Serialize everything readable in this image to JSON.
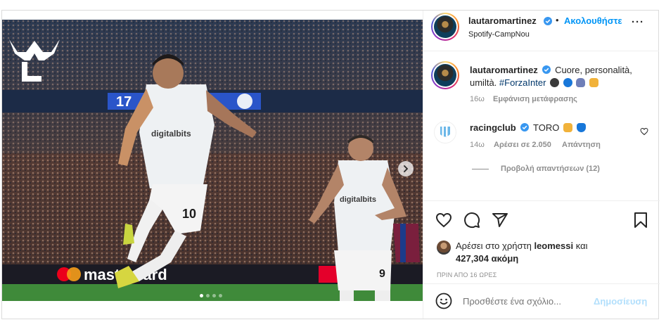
{
  "post": {
    "author": "lautaromartinez",
    "follow_label": "Ακολουθήστε",
    "location": "Spotify-CampNou",
    "dot": "•",
    "more_label": "···"
  },
  "caption": {
    "username": "lautaromartinez",
    "text_line1": "Cuore, personalità,",
    "text_line2_a": "umiltà.",
    "hashtag": "#ForzaInter",
    "time": "16ω",
    "translate_label": "Εμφάνιση μετάφρασης"
  },
  "comment": {
    "username": "racingclub",
    "text": "TORO",
    "time": "14ω",
    "likes": "Αρέσει σε 2.050",
    "reply_label": "Απάντηση",
    "view_replies": "Προβολή απαντήσεων (12)"
  },
  "likes": {
    "prefix": "Αρέσει στο χρήστη",
    "user": "leomessi",
    "suffix": "και",
    "count": "427,304 ακόμη",
    "timestamp": "ΠΡΙΝ ΑΠΟ 16 ΩΡΕΣ"
  },
  "composer": {
    "placeholder": "Προσθέστε ένα σχόλιο...",
    "post_label": "Δημοσίευση"
  },
  "media": {
    "shirt_sponsor": "digitalbits",
    "shirt_number_left": "10",
    "shirt_number_right": "9",
    "board_text": "mastercard",
    "scoreboard_text": "17",
    "carousel_total": 4,
    "carousel_index": 1
  },
  "colors": {
    "accent": "#0095f6",
    "verified": "#3897f0",
    "pitch": "#3f8a3a"
  },
  "icons": [
    "more-icon",
    "verified-icon",
    "heart-icon",
    "comment-icon",
    "share-icon",
    "save-icon",
    "emoji-icon",
    "chevron-right-icon",
    "brand-logo-icon"
  ]
}
